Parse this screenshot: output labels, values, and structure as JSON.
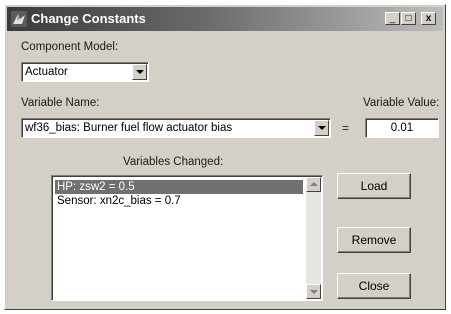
{
  "window": {
    "title": "Change Constants",
    "controls": {
      "minimize": "_",
      "maximize": "□",
      "close": "x"
    }
  },
  "component": {
    "label": "Component  Model:",
    "selected": "Actuator"
  },
  "variable": {
    "label": "Variable Name:",
    "selected": "wf36_bias: Burner fuel flow actuator bias",
    "equals": "="
  },
  "value": {
    "label": "Variable Value:",
    "current": "0.01"
  },
  "changed": {
    "label": "Variables Changed:",
    "items": [
      {
        "text": "HP: zsw2 = 0.5",
        "selected": true
      },
      {
        "text": "Sensor: xn2c_bias = 0.7",
        "selected": false
      }
    ]
  },
  "buttons": {
    "load": "Load",
    "remove": "Remove",
    "close": "Close"
  },
  "icons": [
    "app-icon",
    "minimize-icon",
    "maximize-icon",
    "close-icon",
    "chevron-down-icon",
    "scroll-up-icon",
    "scroll-down-icon"
  ]
}
